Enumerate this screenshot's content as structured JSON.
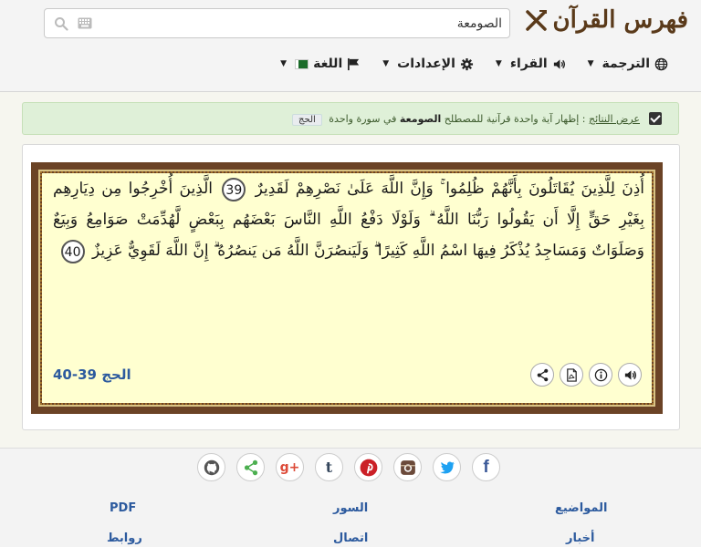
{
  "header": {
    "title": "فهرس القرآن",
    "search": {
      "value": "الصومعة",
      "placeholder": ""
    }
  },
  "menu": {
    "items": [
      {
        "label": "الترجمة",
        "icon": "globe-icon"
      },
      {
        "label": "القراء",
        "icon": "speaker-icon"
      },
      {
        "label": "الإعدادات",
        "icon": "gear-icon"
      },
      {
        "label": "اللغة",
        "icon": "flag-icon"
      }
    ]
  },
  "notice": {
    "label": "عرض النتائج",
    "text_before": ": إظهار آية واحدة قرآنية للمصطلح",
    "term": "الصومعة",
    "text_after": "في سورة واحدة",
    "surah_tag": "الحج"
  },
  "verse": {
    "part1": "أُذِنَ لِلَّذِينَ يُقَاتَلُونَ بِأَنَّهُمْ ظُلِمُوا ۚ وَإِنَّ اللَّهَ عَلَىٰ نَصْرِهِمْ لَقَدِيرٌ",
    "ayah1": "39",
    "part2": "الَّذِينَ أُخْرِجُوا مِن دِيَارِهِم بِغَيْرِ حَقٍّ إِلَّا أَن يَقُولُوا رَبُّنَا اللَّهُ ۗ وَلَوْلَا دَفْعُ اللَّهِ النَّاسَ بَعْضَهُم بِبَعْضٍ لَّهُدِّمَتْ صَوَامِعُ وَبِيَعٌ وَصَلَوَاتٌ وَمَسَاجِدُ يُذْكَرُ فِيهَا اسْمُ اللَّهِ كَثِيرًا ۗ وَلَيَنصُرَنَّ اللَّهُ مَن يَنصُرُهُ ۗ إِنَّ اللَّهَ لَقَوِيٌّ عَزِيزٌ",
    "ayah2": "40",
    "reference": "الحج 39-40"
  },
  "footer": {
    "links": {
      "topics": "المواضيع",
      "surahs": "السور",
      "pdf": "PDF",
      "news": "أخبار",
      "contact": "اتصال",
      "links": "روابط"
    }
  },
  "colors": {
    "brand": "#5a3a1a",
    "link": "#2c5a9e",
    "verse_bg": "#ffffd0",
    "frame": "#6b4326"
  }
}
